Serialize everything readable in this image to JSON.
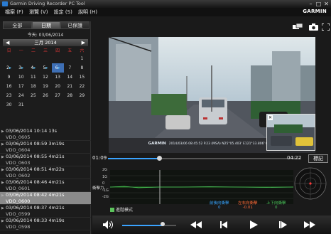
{
  "window": {
    "title": "Garmin Driving Recorder PC Tool"
  },
  "menu": [
    "檔案 (F)",
    "瀏覽 (V)",
    "設定 (S)",
    "說明 (H)"
  ],
  "brand": "GARMIN",
  "tabs": [
    "全部",
    "日期",
    "已保護"
  ],
  "active_tab": 1,
  "today_label": "今天: 03/06/2014",
  "calendar": {
    "month_label": "三月 2014",
    "weekdays": [
      "日",
      "一",
      "二",
      "三",
      "四",
      "五",
      "六"
    ],
    "days": [
      "",
      "",
      "",
      "",
      "",
      "",
      "1",
      "2",
      "3",
      "4",
      "5",
      "6",
      "7",
      "8",
      "9",
      "10",
      "11",
      "12",
      "13",
      "14",
      "15",
      "16",
      "17",
      "18",
      "19",
      "20",
      "21",
      "22",
      "23",
      "24",
      "25",
      "26",
      "27",
      "28",
      "29",
      "30",
      "31",
      "",
      "",
      "",
      "",
      ""
    ],
    "marked_days": [
      "2",
      "3",
      "4",
      "5",
      "6"
    ],
    "selected_day": "6"
  },
  "files": [
    {
      "datetime": "03/06/2014 10:14 13s",
      "name": "VDO_0605"
    },
    {
      "datetime": "03/06/2014 08:59 3m19s",
      "name": "VDO_0604"
    },
    {
      "datetime": "03/06/2014 08:55 4m21s",
      "name": "VDO_0603"
    },
    {
      "datetime": "03/06/2014 08:51 4m22s",
      "name": "VDO_0602"
    },
    {
      "datetime": "03/06/2014 08:46 4m21s",
      "name": "VDO_0601"
    },
    {
      "datetime": "03/06/2014 08:42 4m21s",
      "name": "VDO_0600"
    },
    {
      "datetime": "03/06/2014 08:37 4m21s",
      "name": "VDO_0599"
    },
    {
      "datetime": "03/06/2014 08:33 4m19s",
      "name": "VDO_0598"
    }
  ],
  "selected_file": 5,
  "video": {
    "overlay_brand": "GARMIN",
    "overlay_text": "2014/03/06 08:45:52  P.23 (MSA)  N25°05.403'  E121°33.806'  0km/h"
  },
  "playback": {
    "current_time": "01:09",
    "total_time": "04:22",
    "progress": 0.263,
    "mark_label": "標記"
  },
  "gsensor": {
    "label": "衝擊力",
    "axis": [
      "2G",
      "1G",
      "0",
      "-1G",
      "-2G"
    ],
    "front_back_label": "前後向衝擊",
    "front_back_value": "0",
    "left_right_label": "左右向衝擊",
    "left_right_value": "-0.01",
    "up_down_label": "上下向衝擊",
    "up_down_value": "0",
    "mode_label": "進階模式",
    "colors": {
      "front_back": "#3aa3ff",
      "left_right": "#ff6a3a",
      "up_down": "#4cc35c"
    }
  },
  "volume": 0.75
}
